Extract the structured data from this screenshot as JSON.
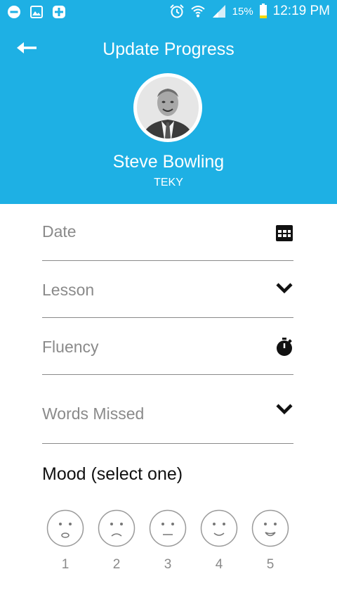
{
  "status_bar": {
    "left_icons": [
      "do-not-disturb-icon",
      "image-icon",
      "health-plus-icon"
    ],
    "right_icons": [
      "alarm-icon",
      "wifi-icon",
      "signal-icon",
      "battery-icon"
    ],
    "battery_percent": "15%",
    "time": "12:19 PM"
  },
  "header": {
    "title": "Update Progress",
    "back_icon": "back-arrow-icon",
    "color": "#1eb0e4"
  },
  "profile": {
    "name": "Steve Bowling",
    "organization": "TEKY"
  },
  "form": {
    "date": {
      "label": "Date",
      "icon": "calendar-icon"
    },
    "lesson": {
      "label": "Lesson",
      "icon": "chevron-down-icon"
    },
    "fluency": {
      "label": "Fluency",
      "icon": "stopwatch-icon"
    },
    "words_missed": {
      "label": "Words Missed",
      "icon": "chevron-down-icon"
    }
  },
  "mood": {
    "title": "Mood (select one)",
    "options": [
      {
        "number": "1"
      },
      {
        "number": "2"
      },
      {
        "number": "3"
      },
      {
        "number": "4"
      },
      {
        "number": "5"
      }
    ]
  }
}
